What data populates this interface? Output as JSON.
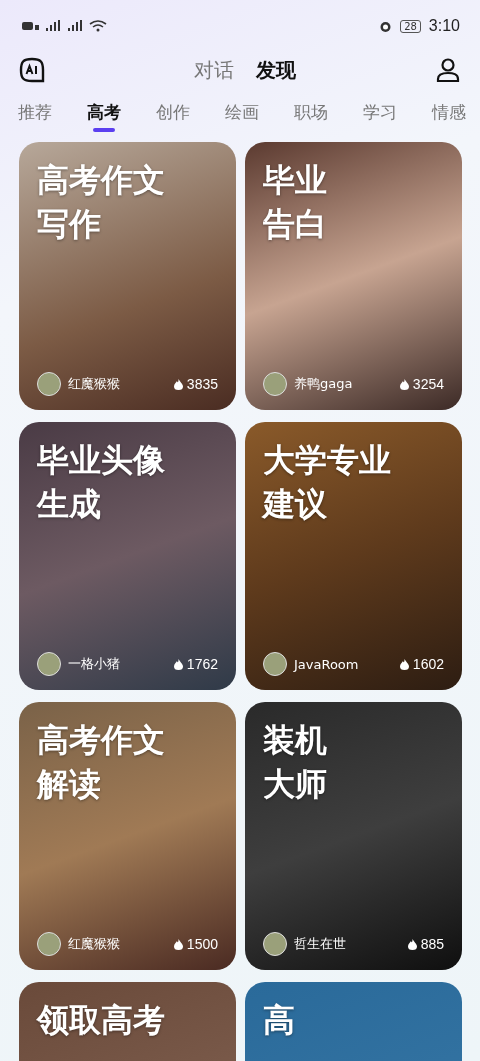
{
  "status_bar": {
    "battery": "28",
    "time": "3:10"
  },
  "header": {
    "tabs": [
      {
        "label": "对话",
        "selected": false
      },
      {
        "label": "发现",
        "selected": true
      }
    ]
  },
  "categories": [
    {
      "label": "推荐",
      "selected": false
    },
    {
      "label": "高考",
      "selected": true
    },
    {
      "label": "创作",
      "selected": false
    },
    {
      "label": "绘画",
      "selected": false
    },
    {
      "label": "职场",
      "selected": false
    },
    {
      "label": "学习",
      "selected": false
    },
    {
      "label": "情感",
      "selected": false
    }
  ],
  "cards": [
    {
      "title_lines": [
        "高考作文",
        "写作"
      ],
      "author": "红魔猴猴",
      "count": "3835"
    },
    {
      "title_lines": [
        "毕业",
        "告白"
      ],
      "author": "养鸭gaga",
      "count": "3254"
    },
    {
      "title_lines": [
        "毕业头像",
        "生成"
      ],
      "author": "一格小猪",
      "count": "1762"
    },
    {
      "title_lines": [
        "大学专业",
        "建议"
      ],
      "author": "JavaRoom",
      "count": "1602"
    },
    {
      "title_lines": [
        "高考作文",
        "解读"
      ],
      "author": "红魔猴猴",
      "count": "1500"
    },
    {
      "title_lines": [
        "装机",
        "大师"
      ],
      "author": "哲生在世",
      "count": "885"
    },
    {
      "title_lines": [
        "领取高考"
      ]
    },
    {
      "title_lines": [
        "高"
      ]
    }
  ]
}
